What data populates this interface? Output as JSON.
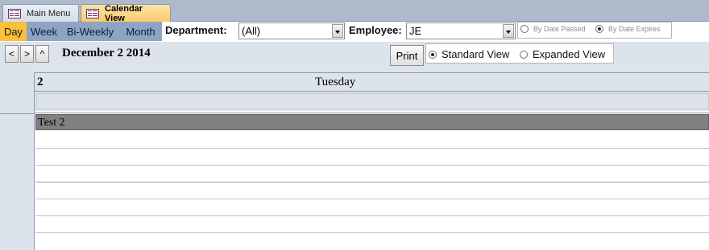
{
  "tabs": [
    {
      "label": "Main Menu",
      "active": false,
      "icon": "form-icon"
    },
    {
      "label": "Calendar View",
      "active": true,
      "icon": "form-icon"
    }
  ],
  "view_buttons": [
    {
      "label": "Day",
      "selected": true
    },
    {
      "label": "Week",
      "selected": false
    },
    {
      "label": "Bi-Weekly",
      "selected": false
    },
    {
      "label": "Month",
      "selected": false
    }
  ],
  "filters": {
    "department_label": "Department:",
    "department_value": "(All)",
    "employee_label": "Employee:",
    "employee_value": "JE"
  },
  "date_filter": {
    "options": [
      {
        "label": "By Date Passed",
        "checked": false
      },
      {
        "label": "By Date Expires",
        "checked": true
      }
    ]
  },
  "navigation": {
    "prev_label": "<",
    "next_label": ">",
    "up_label": "^",
    "date_title": "December 2 2014"
  },
  "print_label": "Print",
  "view_mode": {
    "options": [
      {
        "label": "Standard View",
        "checked": true
      },
      {
        "label": "Expanded View",
        "checked": false
      }
    ]
  },
  "day_header": {
    "day_number": "2",
    "day_name": "Tuesday"
  },
  "events": [
    {
      "title": "Test 2"
    }
  ],
  "colors": {
    "tab_active": "#fbc86b",
    "view_selected": "#fbbf3c",
    "view_button": "#8ea4c2",
    "panel": "#dde3ea",
    "event_bar": "#808080"
  }
}
